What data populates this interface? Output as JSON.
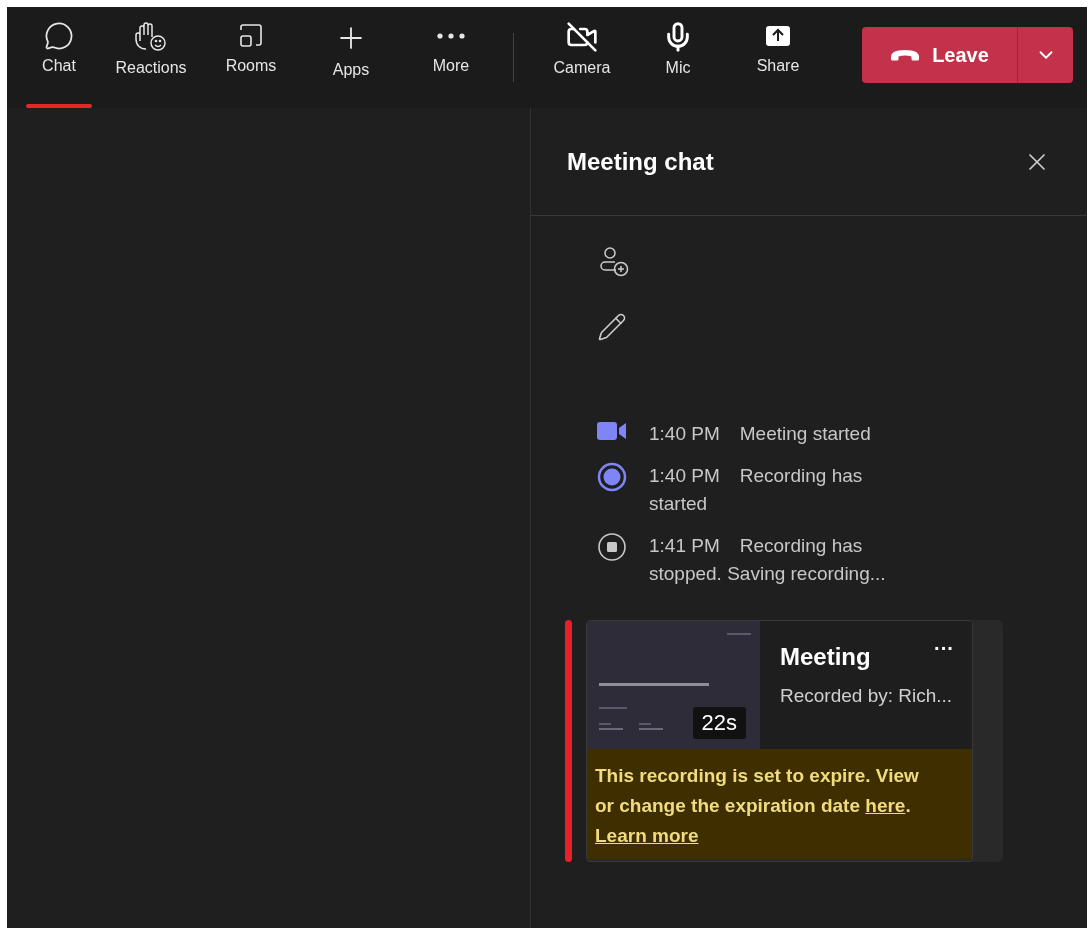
{
  "toolbar": {
    "items": [
      {
        "kind": "chat",
        "label": "Chat",
        "selected": true
      },
      {
        "kind": "reactions",
        "label": "Reactions",
        "selected": false
      },
      {
        "kind": "rooms",
        "label": "Rooms",
        "selected": false
      },
      {
        "kind": "apps",
        "label": "Apps",
        "selected": false
      },
      {
        "kind": "more",
        "label": "More",
        "selected": false
      }
    ],
    "controls": [
      {
        "kind": "camera",
        "label": "Camera"
      },
      {
        "kind": "mic",
        "label": "Mic"
      },
      {
        "kind": "share",
        "label": "Share"
      }
    ],
    "leave": {
      "label": "Leave"
    }
  },
  "chat_panel": {
    "title": "Meeting chat",
    "events": [
      {
        "kind": "meeting",
        "time": "1:40 PM",
        "text": "Meeting started"
      },
      {
        "kind": "recording_started",
        "time": "1:40 PM",
        "text": "Recording has started"
      },
      {
        "kind": "recording_stopped",
        "time": "1:41 PM",
        "text": "Recording has stopped. Saving recording..."
      }
    ],
    "recording": {
      "duration": "22s",
      "title": "Meeting",
      "menu": "···",
      "recorded_by": "Recorded by: Rich...",
      "notice": {
        "text": "This recording is set to expire. View or change the expiration date ",
        "link": "here",
        "after": ".",
        "link2": "Learn more"
      }
    }
  }
}
